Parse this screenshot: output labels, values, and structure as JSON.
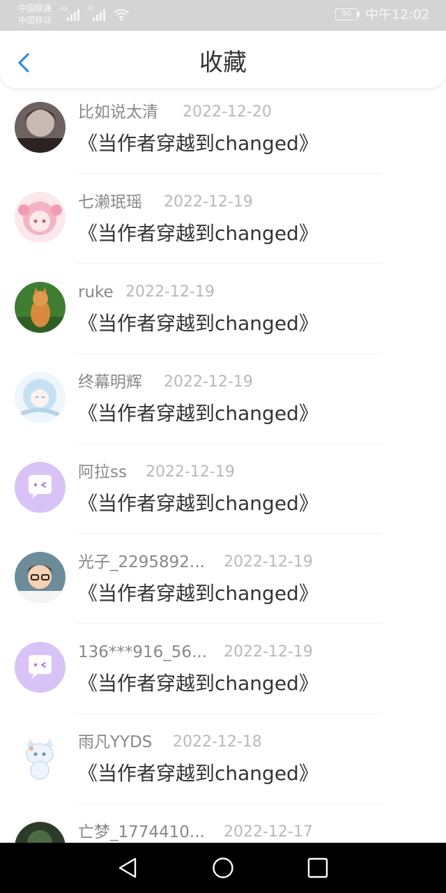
{
  "status_bar": {
    "carrier_1": "中国联通",
    "carrier_2": "中国移动",
    "network_1": "4G",
    "network_2": "2G",
    "battery": "90",
    "time": "中午12:02"
  },
  "header": {
    "title": "收藏"
  },
  "collections": [
    {
      "user": "比如说太清",
      "date": "2022-12-20",
      "book": "《当作者穿越到changed》"
    },
    {
      "user": "七濑珉瑶",
      "date": "2022-12-19",
      "book": "《当作者穿越到changed》"
    },
    {
      "user": "ruke",
      "date": "2022-12-19",
      "book": "《当作者穿越到changed》"
    },
    {
      "user": "终幕明辉",
      "date": "2022-12-19",
      "book": "《当作者穿越到changed》"
    },
    {
      "user": "阿拉ss",
      "date": "2022-12-19",
      "book": "《当作者穿越到changed》"
    },
    {
      "user": "光子_2295892...",
      "date": "2022-12-19",
      "book": "《当作者穿越到changed》"
    },
    {
      "user": "136***916_56...",
      "date": "2022-12-19",
      "book": "《当作者穿越到changed》"
    },
    {
      "user": "雨凡YYDS",
      "date": "2022-12-18",
      "book": "《当作者穿越到changed》"
    },
    {
      "user": "亡梦_1774410...",
      "date": "2022-12-17",
      "book": ""
    }
  ],
  "colors": {
    "accent": "#2a8ee8",
    "default_avatar": "#d8c3f6"
  },
  "icons": {
    "back": "chevron-left-icon",
    "nav_back": "triangle-back-icon",
    "nav_home": "circle-home-icon",
    "nav_recent": "square-recent-icon"
  }
}
